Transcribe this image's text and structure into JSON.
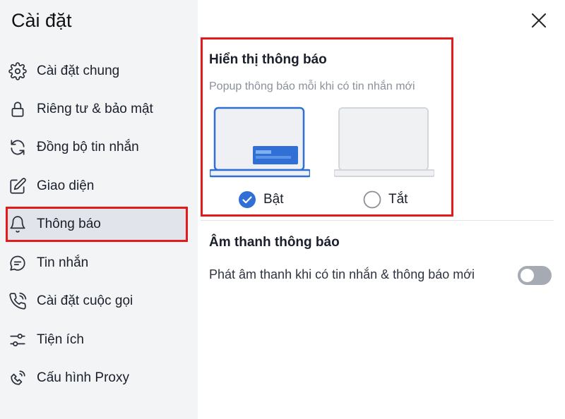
{
  "sidebar": {
    "title": "Cài đặt",
    "items": [
      {
        "label": "Cài đặt chung",
        "icon": "gear-icon"
      },
      {
        "label": "Riêng tư & bảo mật",
        "icon": "lock-icon"
      },
      {
        "label": "Đồng bộ tin nhắn",
        "icon": "sync-icon"
      },
      {
        "label": "Giao diện",
        "icon": "edit-icon"
      },
      {
        "label": "Thông báo",
        "icon": "bell-icon",
        "active": true
      },
      {
        "label": "Tin nhắn",
        "icon": "chat-icon"
      },
      {
        "label": "Cài đặt cuộc gọi",
        "icon": "phone-icon"
      },
      {
        "label": "Tiện ích",
        "icon": "sliders-icon"
      },
      {
        "label": "Cấu hình Proxy",
        "icon": "proxy-icon"
      }
    ]
  },
  "notification_display": {
    "title": "Hiển thị thông báo",
    "subtitle": "Popup thông báo mỗi khi có tin nhắn mới",
    "options": [
      {
        "label": "Bật",
        "selected": true
      },
      {
        "label": "Tắt",
        "selected": false
      }
    ]
  },
  "notification_sound": {
    "title": "Âm thanh thông báo",
    "description": "Phát âm thanh khi có tin nhắn & thông báo mới",
    "enabled": false
  },
  "colors": {
    "accent": "#2f6fd6",
    "highlight_border": "#e31b1b",
    "sidebar_bg": "#f3f4f6",
    "toggle_off": "#a5aab3"
  }
}
